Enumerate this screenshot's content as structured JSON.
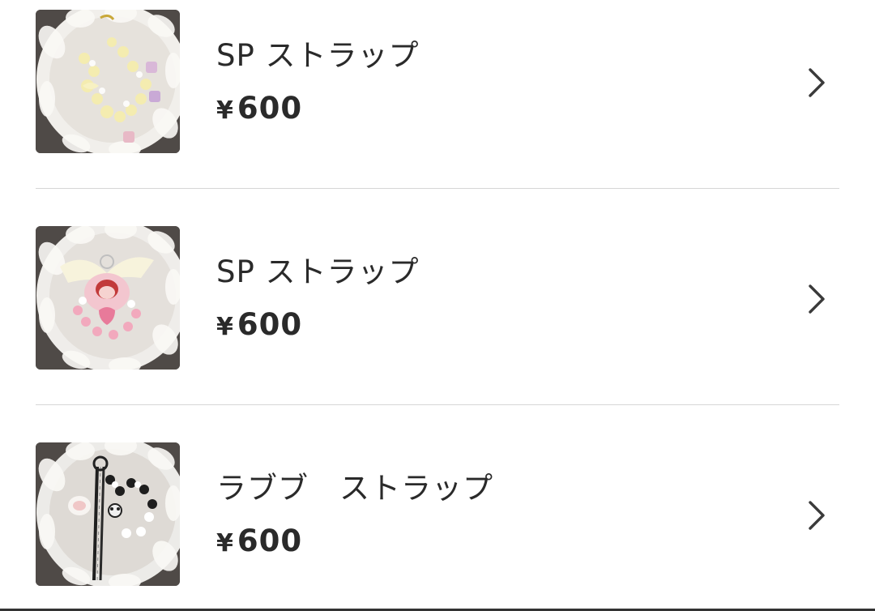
{
  "items": [
    {
      "title": "SP ストラップ",
      "price_yen": "¥",
      "price_value": "600",
      "thumb_theme": "cream",
      "accent": "#f3ecb8"
    },
    {
      "title": "SP ストラップ",
      "price_yen": "¥",
      "price_value": "600",
      "thumb_theme": "pink",
      "accent": "#f2b6c6"
    },
    {
      "title": "ラブブ　ストラップ",
      "price_yen": "¥",
      "price_value": "600",
      "thumb_theme": "mono",
      "accent": "#1e1e1e"
    }
  ],
  "icons": {
    "chevron": "chevron-right-icon"
  }
}
